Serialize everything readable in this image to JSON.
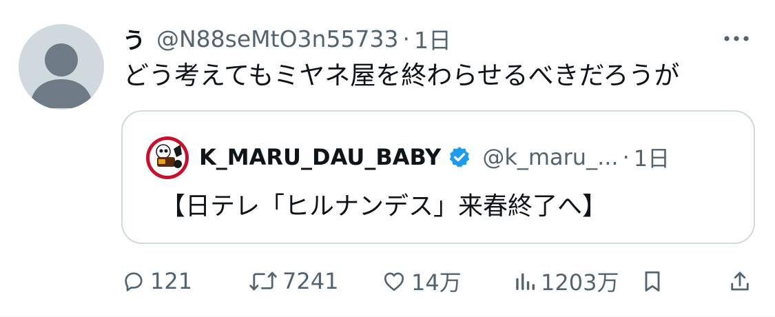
{
  "tweet": {
    "author_name": "う",
    "author_handle": "@N88seMtO3n55733",
    "separator": "·",
    "time": "1日",
    "text": "どう考えてもミヤネ屋を終わらせるべきだろうが",
    "more_icon": "more-horizontal-icon"
  },
  "quote": {
    "author_name": "K_MARU_DAU_BABY",
    "verified_icon": "verified-badge-icon",
    "author_handle": "@k_maru_...",
    "separator": "·",
    "time": "1日",
    "text": "【日テレ「ヒルナンデス」来春終了へ】"
  },
  "actions": {
    "reply_count": "121",
    "retweet_count": "7241",
    "like_count": "14万",
    "views_count": "1203万",
    "reply_icon": "reply-icon",
    "retweet_icon": "retweet-icon",
    "like_icon": "heart-icon",
    "views_icon": "views-icon",
    "bookmark_icon": "bookmark-icon",
    "share_icon": "share-icon"
  },
  "colors": {
    "primary_text": "#0f1419",
    "secondary_text": "#536471",
    "border": "#cfd9de",
    "avatar_bg": "#cfd9de",
    "verified_blue": "#1d9bf0"
  }
}
